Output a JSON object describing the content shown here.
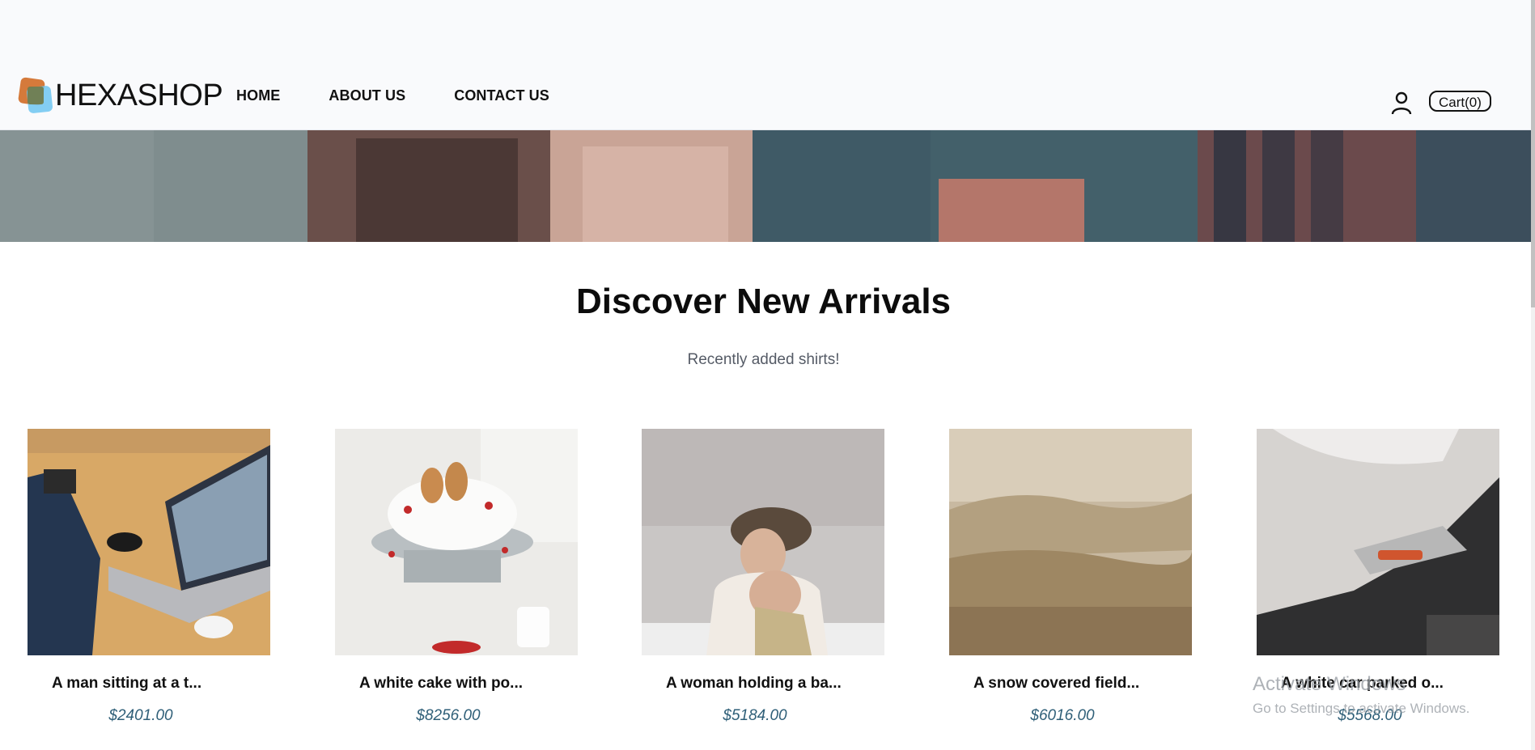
{
  "header": {
    "logo_text": "HEXASHOP",
    "nav": [
      {
        "label": "HOME"
      },
      {
        "label": "ABOUT US"
      },
      {
        "label": "CONTACT US"
      }
    ],
    "cart_label": "Cart(0)"
  },
  "section": {
    "title": "Discover New Arrivals",
    "subtitle": "Recently added shirts!"
  },
  "products": [
    {
      "name": "A man sitting at a t...",
      "price": "$2401.00",
      "image": "man-laptop-phone"
    },
    {
      "name": "A white cake with po...",
      "price": "$8256.00",
      "image": "white-cake-pears"
    },
    {
      "name": "A woman holding a ba...",
      "price": "$5184.00",
      "image": "woman-baby-snow"
    },
    {
      "name": "A snow covered field...",
      "price": "$6016.00",
      "image": "misty-forest-field"
    },
    {
      "name": "A white car parked o...",
      "price": "$5568.00",
      "image": "white-vintage-car"
    }
  ],
  "watermark": {
    "line1": "Activate Windows",
    "line2": "Go to Settings to activate Windows."
  },
  "colors": {
    "header_bg": "#f9fafc",
    "price": "#2f5f78",
    "logo_orange": "#d57a3b",
    "logo_blue": "#6ec6f1"
  }
}
